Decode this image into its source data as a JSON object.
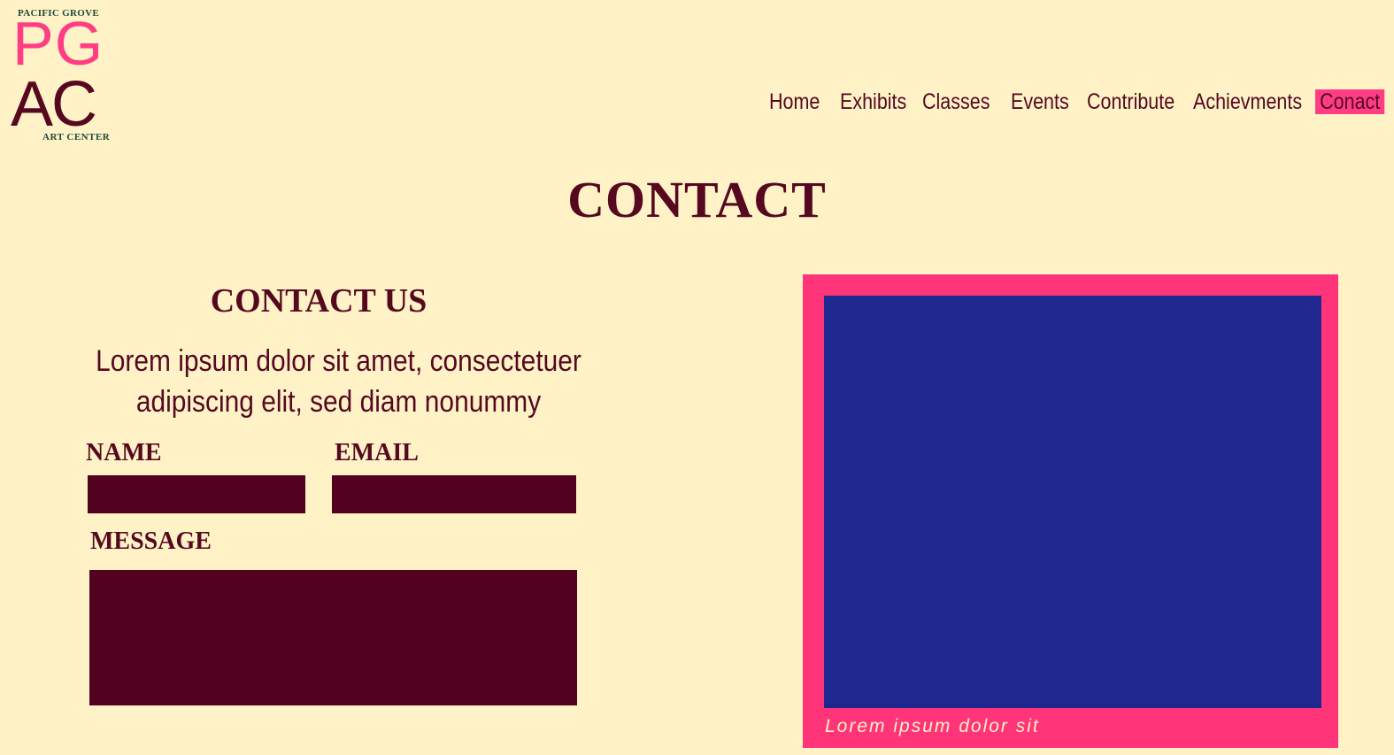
{
  "logo": {
    "top_text": "PACIFIC GROVE",
    "initials_top": "PG",
    "initials_bottom": "AC",
    "bottom_text": "ART CENTER"
  },
  "nav": {
    "items": [
      {
        "label": "Home",
        "active": false
      },
      {
        "label": "Exhibits",
        "active": false
      },
      {
        "label": "Classes",
        "active": false
      },
      {
        "label": "Events",
        "active": false
      },
      {
        "label": "Contribute",
        "active": false
      },
      {
        "label": "Achievments",
        "active": false
      },
      {
        "label": "Conact",
        "active": true
      }
    ]
  },
  "page": {
    "title": "CONTACT"
  },
  "contact": {
    "heading": "CONTACT US",
    "text": "Lorem ipsum dolor sit amet, consectetuer adipiscing elit, sed diam nonummy",
    "name_label": "NAME",
    "name_value": "",
    "email_label": "EMAIL",
    "email_value": "",
    "message_label": "MESSAGE",
    "message_value": ""
  },
  "card": {
    "caption": "Lorem ipsum dolor sit"
  },
  "colors": {
    "background": "#fff2c7",
    "primary": "#55081f",
    "accent": "#ff3d84",
    "image_placeholder": "#20278e"
  }
}
